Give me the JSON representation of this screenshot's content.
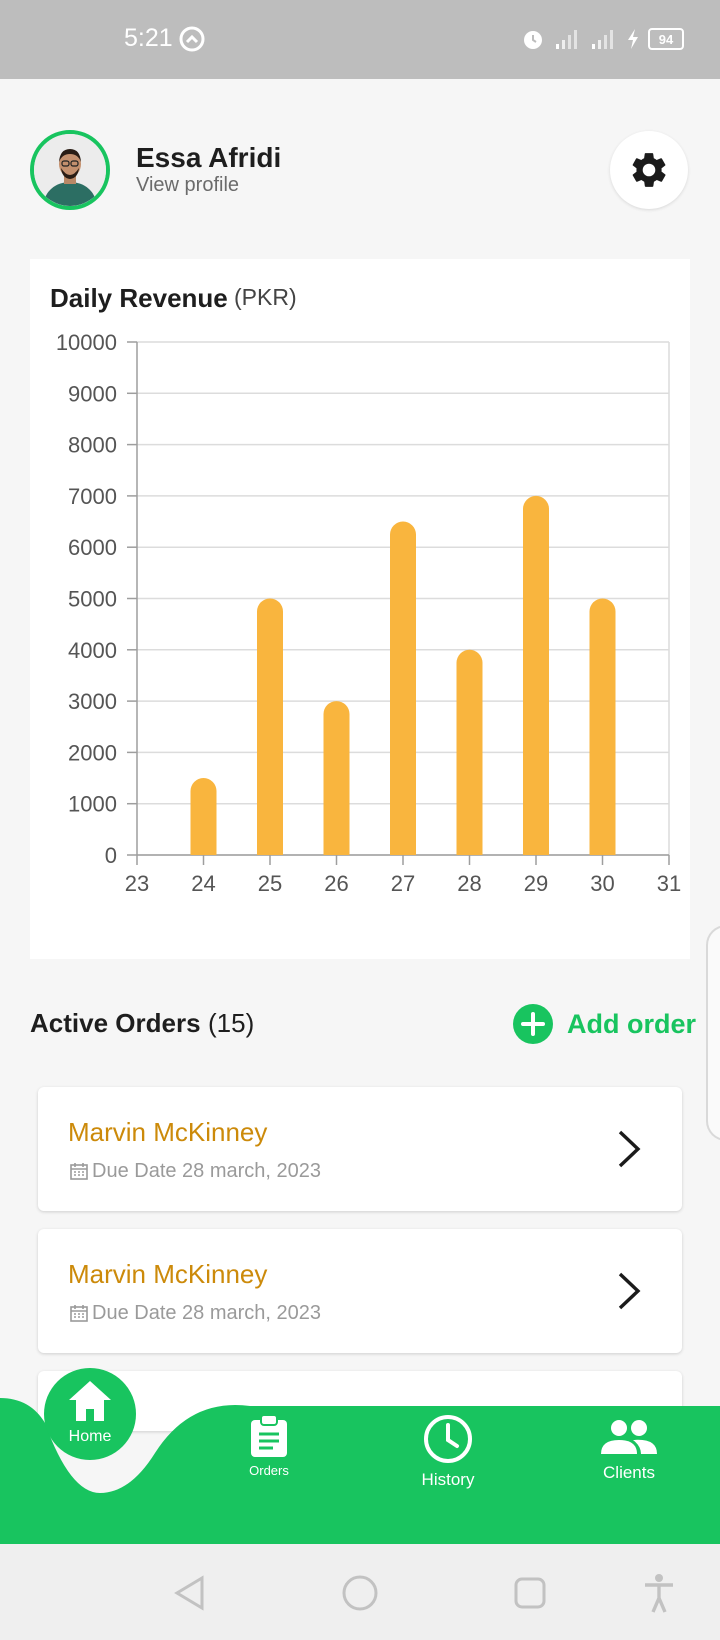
{
  "status_bar": {
    "time": "5:21",
    "battery": "94"
  },
  "profile": {
    "name": "Essa Afridi",
    "subtitle": "View profile"
  },
  "chart_data": {
    "type": "bar",
    "title": "Daily Revenue",
    "unit_label": "(PKR)",
    "x": [
      24,
      25,
      26,
      27,
      28,
      29,
      30
    ],
    "values": [
      1500,
      5000,
      3000,
      6500,
      4000,
      7000,
      5000
    ],
    "xlim": [
      23,
      31
    ],
    "ylim": [
      0,
      10000
    ],
    "x_ticks": [
      "23",
      "24",
      "25",
      "26",
      "27",
      "28",
      "29",
      "30",
      "31"
    ],
    "y_ticks": [
      "0",
      "1000",
      "2000",
      "3000",
      "4000",
      "5000",
      "6000",
      "7000",
      "8000",
      "9000",
      "10000"
    ],
    "bar_color": "#f9b53e",
    "grid": true
  },
  "orders": {
    "title": "Active Orders",
    "count": "(15)",
    "add_label": "Add order",
    "items": [
      {
        "name": "Marvin McKinney",
        "due": "Due Date 28 march, 2023"
      },
      {
        "name": "Marvin McKinney",
        "due": "Due Date 28 march, 2023"
      }
    ]
  },
  "nav": {
    "home": "Home",
    "orders": "Orders",
    "history": "History",
    "clients": "Clients"
  },
  "colors": {
    "accent": "#18c45f",
    "order_name": "#cc8a0a"
  }
}
